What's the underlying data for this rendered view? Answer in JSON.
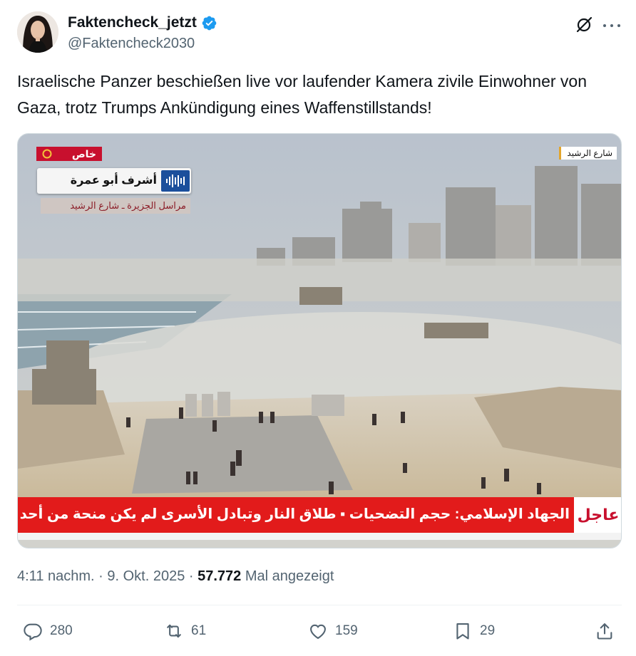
{
  "author": {
    "display_name": "Faktencheck_jetzt",
    "handle": "@Faktencheck2030",
    "verified": true
  },
  "icons": {
    "verified": "verified-badge-icon",
    "grok": "grok-icon",
    "more": "more-options-icon",
    "reply": "reply-icon",
    "repost": "repost-icon",
    "like": "like-icon",
    "bookmark": "bookmark-icon",
    "share": "share-icon"
  },
  "tweet": {
    "text": "Israelische Panzer beschießen live vor laufender Kamera zivile Einwohner von Gaza, trotz Trumps Ankündigung eines Waffenstillstands!"
  },
  "media": {
    "overlay": {
      "special_tag": "خاص",
      "reporter_name": "أشرف أبو عمرة",
      "reporter_title": "مراسل الجزيرة ـ شارع الرشيد",
      "location_tag": "شارع الرشيد",
      "ticker_label": "عاجل",
      "ticker_text": "الجهاد الإسلامي: حجم التضحيات  ▪  طلاق النار وتبادل الأسرى لم يكن منحة من أحد"
    }
  },
  "meta": {
    "time": "4:11 nachm.",
    "date": "9. Okt. 2025",
    "views_count": "57.772",
    "views_label": "Mal angezeigt"
  },
  "actions": {
    "replies": "280",
    "reposts": "61",
    "likes": "159",
    "bookmarks": "29"
  },
  "colors": {
    "text_primary": "#0f1419",
    "text_secondary": "#536471",
    "verified_blue": "#1d9bf0",
    "ticker_red": "#e21b1b"
  }
}
